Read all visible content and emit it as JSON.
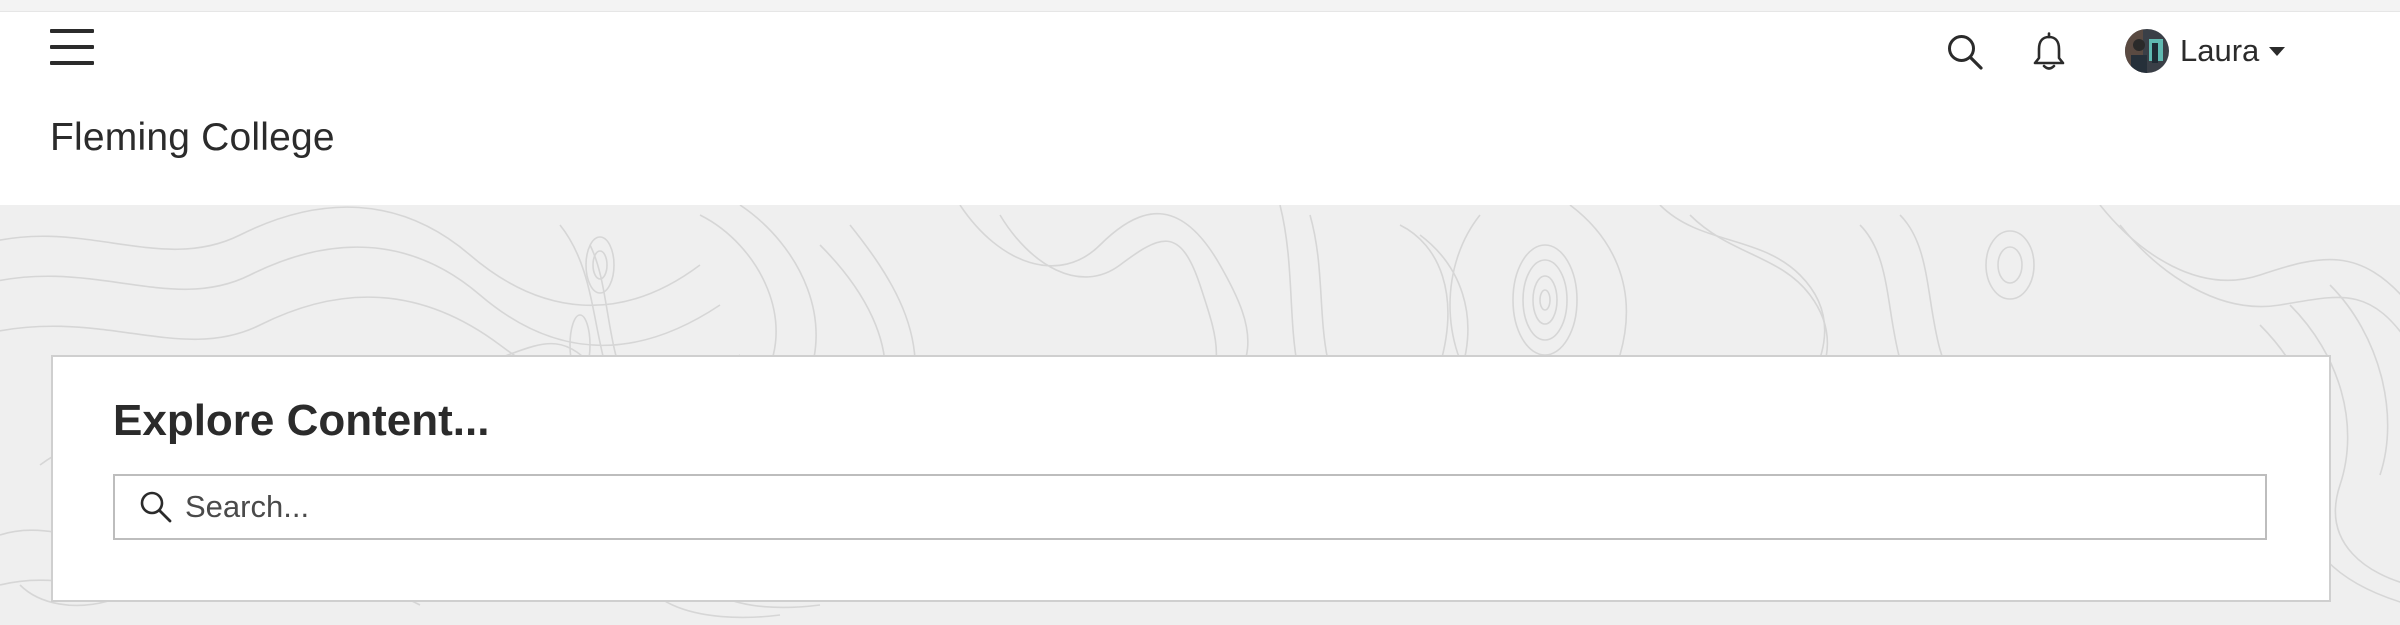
{
  "header": {
    "site_title": "Fleming College",
    "menu_icon": "hamburger-menu-icon",
    "search_icon": "search-icon",
    "notifications_icon": "bell-icon",
    "user": {
      "name": "Laura",
      "avatar_icon": "user-avatar",
      "menu_icon": "caret-down-icon"
    }
  },
  "explore": {
    "title": "Explore Content...",
    "search_placeholder": "Search...",
    "search_value": ""
  },
  "colors": {
    "text": "#2b2b2b",
    "hero_background": "#efefef",
    "panel_border": "#cfcfcf",
    "input_border": "#bdbdbd"
  }
}
